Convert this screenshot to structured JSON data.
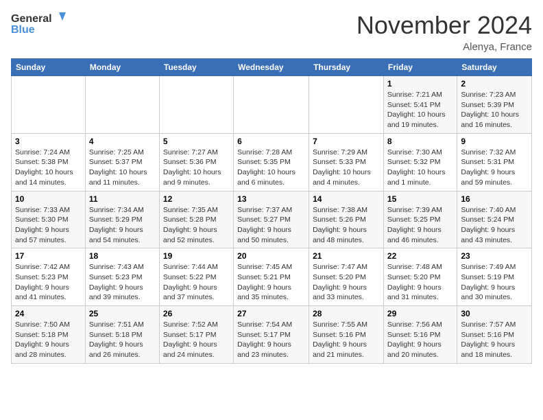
{
  "header": {
    "logo_line1": "General",
    "logo_line2": "Blue",
    "month": "November 2024",
    "location": "Alenya, France"
  },
  "weekdays": [
    "Sunday",
    "Monday",
    "Tuesday",
    "Wednesday",
    "Thursday",
    "Friday",
    "Saturday"
  ],
  "weeks": [
    [
      {
        "num": "",
        "info": ""
      },
      {
        "num": "",
        "info": ""
      },
      {
        "num": "",
        "info": ""
      },
      {
        "num": "",
        "info": ""
      },
      {
        "num": "",
        "info": ""
      },
      {
        "num": "1",
        "info": "Sunrise: 7:21 AM\nSunset: 5:41 PM\nDaylight: 10 hours and 19 minutes."
      },
      {
        "num": "2",
        "info": "Sunrise: 7:23 AM\nSunset: 5:39 PM\nDaylight: 10 hours and 16 minutes."
      }
    ],
    [
      {
        "num": "3",
        "info": "Sunrise: 7:24 AM\nSunset: 5:38 PM\nDaylight: 10 hours and 14 minutes."
      },
      {
        "num": "4",
        "info": "Sunrise: 7:25 AM\nSunset: 5:37 PM\nDaylight: 10 hours and 11 minutes."
      },
      {
        "num": "5",
        "info": "Sunrise: 7:27 AM\nSunset: 5:36 PM\nDaylight: 10 hours and 9 minutes."
      },
      {
        "num": "6",
        "info": "Sunrise: 7:28 AM\nSunset: 5:35 PM\nDaylight: 10 hours and 6 minutes."
      },
      {
        "num": "7",
        "info": "Sunrise: 7:29 AM\nSunset: 5:33 PM\nDaylight: 10 hours and 4 minutes."
      },
      {
        "num": "8",
        "info": "Sunrise: 7:30 AM\nSunset: 5:32 PM\nDaylight: 10 hours and 1 minute."
      },
      {
        "num": "9",
        "info": "Sunrise: 7:32 AM\nSunset: 5:31 PM\nDaylight: 9 hours and 59 minutes."
      }
    ],
    [
      {
        "num": "10",
        "info": "Sunrise: 7:33 AM\nSunset: 5:30 PM\nDaylight: 9 hours and 57 minutes."
      },
      {
        "num": "11",
        "info": "Sunrise: 7:34 AM\nSunset: 5:29 PM\nDaylight: 9 hours and 54 minutes."
      },
      {
        "num": "12",
        "info": "Sunrise: 7:35 AM\nSunset: 5:28 PM\nDaylight: 9 hours and 52 minutes."
      },
      {
        "num": "13",
        "info": "Sunrise: 7:37 AM\nSunset: 5:27 PM\nDaylight: 9 hours and 50 minutes."
      },
      {
        "num": "14",
        "info": "Sunrise: 7:38 AM\nSunset: 5:26 PM\nDaylight: 9 hours and 48 minutes."
      },
      {
        "num": "15",
        "info": "Sunrise: 7:39 AM\nSunset: 5:25 PM\nDaylight: 9 hours and 46 minutes."
      },
      {
        "num": "16",
        "info": "Sunrise: 7:40 AM\nSunset: 5:24 PM\nDaylight: 9 hours and 43 minutes."
      }
    ],
    [
      {
        "num": "17",
        "info": "Sunrise: 7:42 AM\nSunset: 5:23 PM\nDaylight: 9 hours and 41 minutes."
      },
      {
        "num": "18",
        "info": "Sunrise: 7:43 AM\nSunset: 5:23 PM\nDaylight: 9 hours and 39 minutes."
      },
      {
        "num": "19",
        "info": "Sunrise: 7:44 AM\nSunset: 5:22 PM\nDaylight: 9 hours and 37 minutes."
      },
      {
        "num": "20",
        "info": "Sunrise: 7:45 AM\nSunset: 5:21 PM\nDaylight: 9 hours and 35 minutes."
      },
      {
        "num": "21",
        "info": "Sunrise: 7:47 AM\nSunset: 5:20 PM\nDaylight: 9 hours and 33 minutes."
      },
      {
        "num": "22",
        "info": "Sunrise: 7:48 AM\nSunset: 5:20 PM\nDaylight: 9 hours and 31 minutes."
      },
      {
        "num": "23",
        "info": "Sunrise: 7:49 AM\nSunset: 5:19 PM\nDaylight: 9 hours and 30 minutes."
      }
    ],
    [
      {
        "num": "24",
        "info": "Sunrise: 7:50 AM\nSunset: 5:18 PM\nDaylight: 9 hours and 28 minutes."
      },
      {
        "num": "25",
        "info": "Sunrise: 7:51 AM\nSunset: 5:18 PM\nDaylight: 9 hours and 26 minutes."
      },
      {
        "num": "26",
        "info": "Sunrise: 7:52 AM\nSunset: 5:17 PM\nDaylight: 9 hours and 24 minutes."
      },
      {
        "num": "27",
        "info": "Sunrise: 7:54 AM\nSunset: 5:17 PM\nDaylight: 9 hours and 23 minutes."
      },
      {
        "num": "28",
        "info": "Sunrise: 7:55 AM\nSunset: 5:16 PM\nDaylight: 9 hours and 21 minutes."
      },
      {
        "num": "29",
        "info": "Sunrise: 7:56 AM\nSunset: 5:16 PM\nDaylight: 9 hours and 20 minutes."
      },
      {
        "num": "30",
        "info": "Sunrise: 7:57 AM\nSunset: 5:16 PM\nDaylight: 9 hours and 18 minutes."
      }
    ]
  ]
}
